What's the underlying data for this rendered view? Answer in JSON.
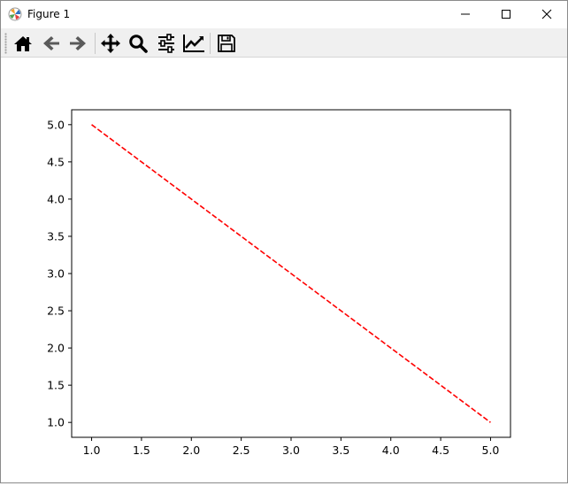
{
  "window": {
    "title": "Figure 1"
  },
  "titlebar_buttons": {
    "minimize": "minimize-icon",
    "maximize": "maximize-icon",
    "close": "close-icon"
  },
  "toolbar": {
    "icons": [
      "home-icon",
      "back-arrow-icon",
      "forward-arrow-icon",
      "pan-icon",
      "zoom-icon",
      "configure-subplots-icon",
      "edit-axis-icon",
      "save-icon"
    ]
  },
  "chart_data": {
    "type": "line",
    "title": "",
    "xlabel": "",
    "ylabel": "",
    "x": [
      1,
      2,
      3,
      4,
      5
    ],
    "series": [
      {
        "values": [
          5,
          4,
          3,
          2,
          1
        ],
        "color": "#ff0000",
        "style": "dashed"
      }
    ],
    "xlim": [
      0.8,
      5.2
    ],
    "ylim": [
      0.8,
      5.2
    ],
    "xticks": [
      "1.0",
      "1.5",
      "2.0",
      "2.5",
      "3.0",
      "3.5",
      "4.0",
      "4.5",
      "5.0"
    ],
    "yticks": [
      "1.0",
      "1.5",
      "2.0",
      "2.5",
      "3.0",
      "3.5",
      "4.0",
      "4.5",
      "5.0"
    ],
    "grid": false,
    "legend": false
  }
}
